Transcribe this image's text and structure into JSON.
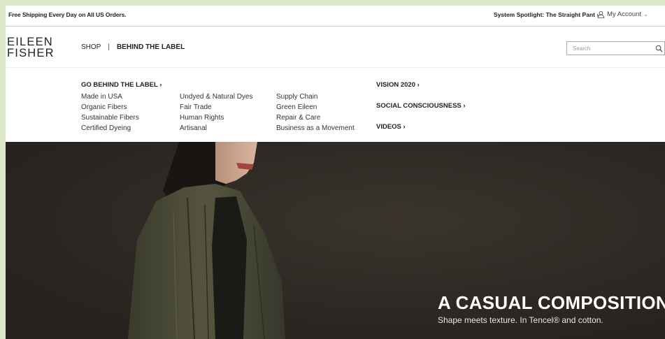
{
  "utility": {
    "shipping_text": "Free Shipping Every Day on All US Orders.",
    "spotlight_text": "System Spotlight: The Straight Pant ›",
    "account_label": "My Account",
    "account_chevron": "⌄"
  },
  "header": {
    "logo_line1": "EILEEN",
    "logo_line2": "FISHER",
    "nav": {
      "shop": "SHOP",
      "separator": "|",
      "behind_the_label": "BEHIND THE LABEL"
    },
    "search": {
      "placeholder": "Search",
      "value": ""
    }
  },
  "mega_menu": {
    "main_heading": "GO BEHIND THE LABEL ›",
    "columns": [
      [
        "Made in USA",
        "Organic Fibers",
        "Sustainable Fibers",
        "Certified Dyeing"
      ],
      [
        "Undyed & Natural Dyes",
        "Fair Trade",
        "Human Rights",
        "Artisanal"
      ],
      [
        "Supply Chain",
        "Green Eileen",
        "Repair & Care",
        "Business as a Movement"
      ]
    ],
    "side_links": [
      "VISION 2020 ›",
      "SOCIAL CONSCIOUSNESS ›",
      "VIDEOS ›"
    ]
  },
  "hero": {
    "title": "A CASUAL COMPOSITION",
    "subtitle": "Shape meets texture. In Tencel® and cotton."
  },
  "colors": {
    "page_bg": "#ffffff",
    "frame_bg": "#dde8c8",
    "hero_bg": "#2d2924",
    "jacket": "#4a4a3a",
    "text": "#222222"
  }
}
